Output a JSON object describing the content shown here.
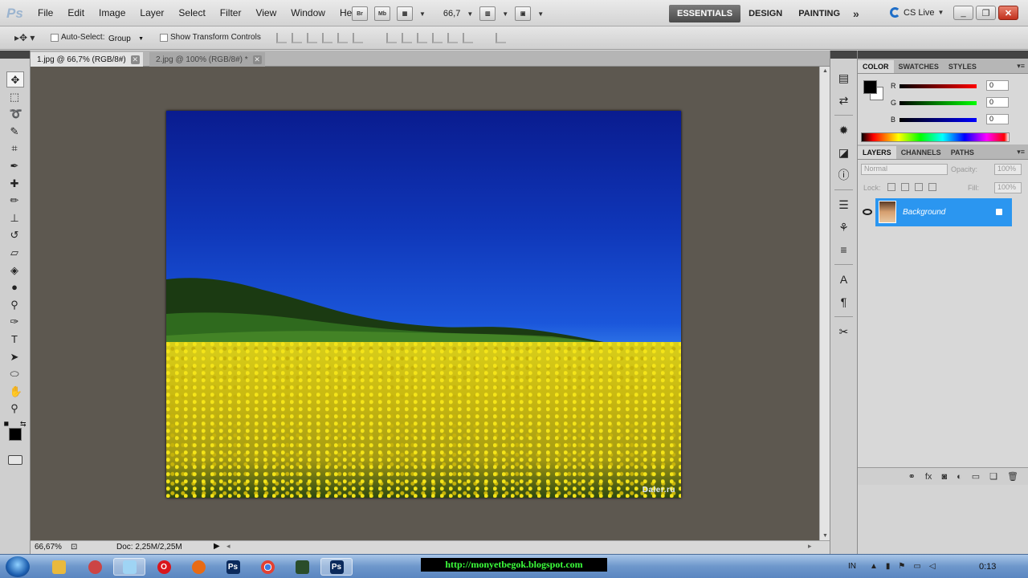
{
  "app": {
    "logo": "Ps",
    "menus": [
      "File",
      "Edit",
      "Image",
      "Layer",
      "Select",
      "Filter",
      "View",
      "Window",
      "Help"
    ],
    "app_buttons": [
      {
        "label": "Br",
        "icon": "bridge-icon"
      },
      {
        "label": "Mb",
        "icon": "minibridge-icon"
      }
    ],
    "zoom_level": "66,7",
    "workspaces": [
      "ESSENTIALS",
      "DESIGN",
      "PAINTING"
    ],
    "active_workspace": "ESSENTIALS",
    "more_workspaces": "»",
    "cs_live": "CS Live"
  },
  "options_bar": {
    "auto_select_label": "Auto-Select:",
    "auto_select_value": "Group",
    "show_transform_label": "Show Transform Controls"
  },
  "documents": [
    {
      "title": "1.jpg @ 66,7% (RGB/8#)",
      "active": true
    },
    {
      "title": "2.jpg @ 100% (RGB/8#) *",
      "active": false
    }
  ],
  "canvas": {
    "watermark": "Daler.ru",
    "colors": {
      "background": "#5d5850",
      "sky_top": "#0a1c8f",
      "sky_bottom": "#3b88f0",
      "field": "#d9cf1a"
    }
  },
  "status": {
    "zoom": "66,67%",
    "doc_size": "Doc: 2,25M/2,25M"
  },
  "color_panel": {
    "tabs": [
      "COLOR",
      "SWATCHES",
      "STYLES"
    ],
    "channels": [
      {
        "label": "R",
        "value": "0"
      },
      {
        "label": "G",
        "value": "0"
      },
      {
        "label": "B",
        "value": "0"
      }
    ]
  },
  "layers_panel": {
    "tabs": [
      "LAYERS",
      "CHANNELS",
      "PATHS"
    ],
    "blend_mode": "Normal",
    "opacity_label": "Opacity:",
    "opacity_value": "100%",
    "lock_label": "Lock:",
    "fill_label": "Fill:",
    "fill_value": "100%",
    "layers": [
      {
        "name": "Background",
        "selected": true,
        "locked": true
      }
    ]
  },
  "taskbar": {
    "blog_url": "http://monyetbegok.blogspot.com",
    "lang": "IN",
    "time": "0:13"
  }
}
